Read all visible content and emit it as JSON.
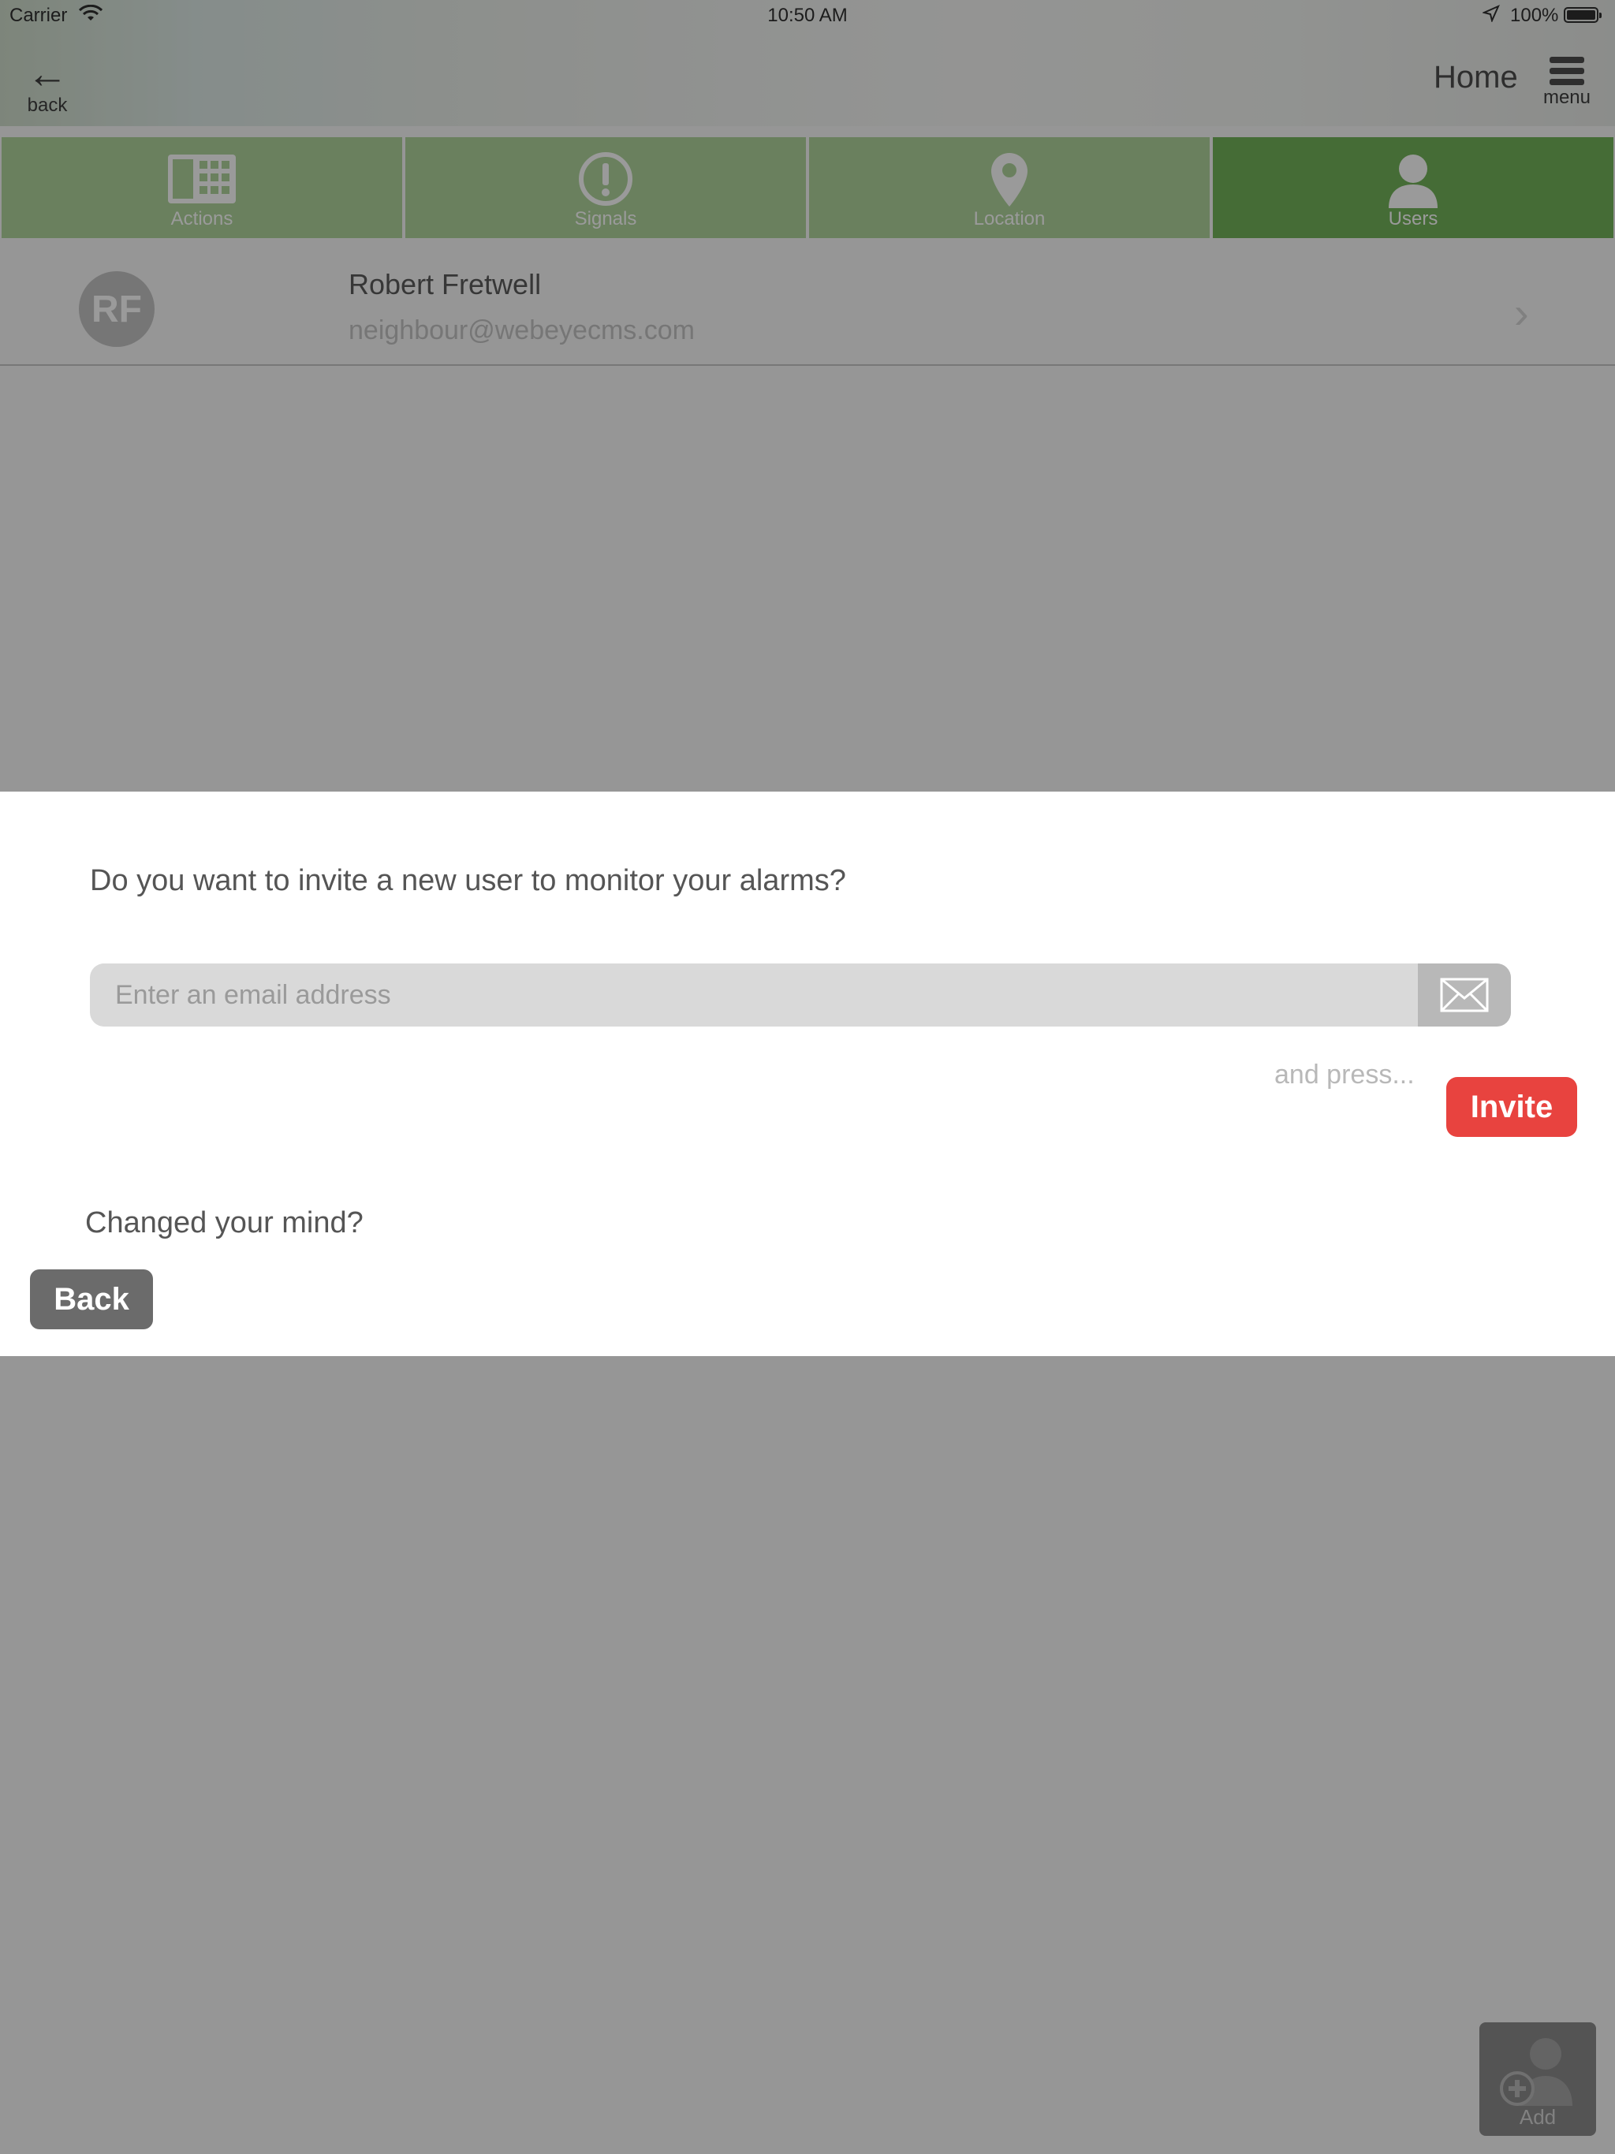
{
  "status_bar": {
    "carrier": "Carrier",
    "time": "10:50 AM",
    "battery": "100%"
  },
  "nav": {
    "back_label": "back",
    "title": "Home",
    "menu_label": "menu"
  },
  "tabs": [
    {
      "label": "Actions",
      "icon": "keypad-icon",
      "active": false
    },
    {
      "label": "Signals",
      "icon": "exclamation-icon",
      "active": false
    },
    {
      "label": "Location",
      "icon": "map-pin-icon",
      "active": false
    },
    {
      "label": "Users",
      "icon": "user-icon",
      "active": true
    }
  ],
  "user": {
    "initials": "RF",
    "name": "Robert Fretwell",
    "email": "neighbour@webeyecms.com"
  },
  "modal": {
    "question": "Do you want to invite a new user to monitor your alarms?",
    "email_placeholder": "Enter an email address",
    "email_value": "",
    "and_press": "and press...",
    "invite_label": "Invite",
    "changed_mind": "Changed your mind?",
    "back_label": "Back"
  },
  "fab": {
    "label": "Add",
    "icon": "add-user-icon"
  },
  "colors": {
    "tab_green": "#a4cf8f",
    "tab_active_green": "#5fa943",
    "invite_red": "#e8433f",
    "back_gray": "#6b6b6b"
  }
}
